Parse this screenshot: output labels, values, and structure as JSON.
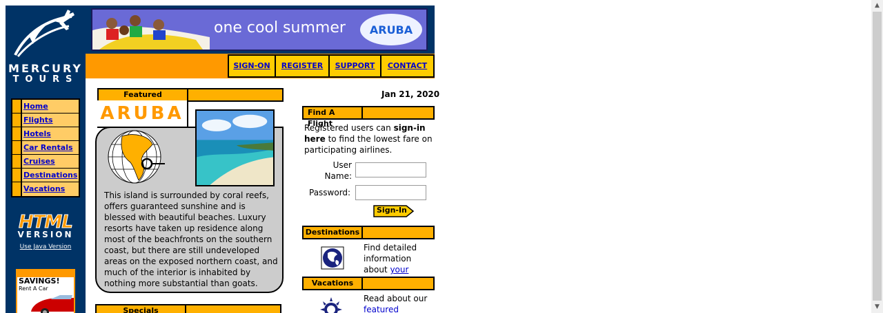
{
  "brand": {
    "logo_line1": "MERCURY",
    "logo_line2": "TOURS"
  },
  "sidebar": {
    "items": [
      {
        "label": "Home"
      },
      {
        "label": "Flights"
      },
      {
        "label": "Hotels"
      },
      {
        "label": "Car Rentals"
      },
      {
        "label": "Cruises"
      },
      {
        "label": "Destinations"
      },
      {
        "label": "Vacations"
      }
    ],
    "html_badge": "HTML",
    "html_badge_sub": "VERSION",
    "java_link": "Use Java Version",
    "ad_title": "SAVINGS!",
    "ad_sub": "Rent A Car"
  },
  "banner": {
    "text": "one cool summer",
    "logo": "ARUBA"
  },
  "topnav": {
    "items": [
      {
        "label": "SIGN-ON"
      },
      {
        "label": "REGISTER"
      },
      {
        "label": "SUPPORT"
      },
      {
        "label": "CONTACT"
      }
    ]
  },
  "featured": {
    "heading": "Featured Destination",
    "name": "ARUBA",
    "description": "This island is surrounded by coral reefs, offers guaranteed sunshine and is blessed with beautiful beaches. Luxury resorts have taken up residence along most of the beachfronts on the southern coast, but there are still undeveloped areas on the exposed northern coast, and much of the interior is inhabited by nothing more substantial than goats."
  },
  "specials": {
    "heading": "Specials"
  },
  "date": "Jan 21, 2020",
  "find_flight": {
    "heading": "Find A Flight",
    "text_before": "Registered users can ",
    "text_bold": "sign-in here",
    "text_after": " to find the lowest fare on participating airlines.",
    "user_label": "User Name:",
    "password_label": "Password:",
    "user_value": "",
    "password_value": "",
    "signin_label": "Sign-In"
  },
  "destinations": {
    "heading": "Destinations",
    "text_before": "Find detailed information about ",
    "link": "your destination",
    "text_after": "."
  },
  "vacations": {
    "heading": "Vacations",
    "text_before": "Read about our ",
    "link": "featured vacation"
  },
  "colors": {
    "navy": "#003366",
    "orange": "#ff9900",
    "gold": "#ffcc00",
    "link": "#0000cc"
  }
}
